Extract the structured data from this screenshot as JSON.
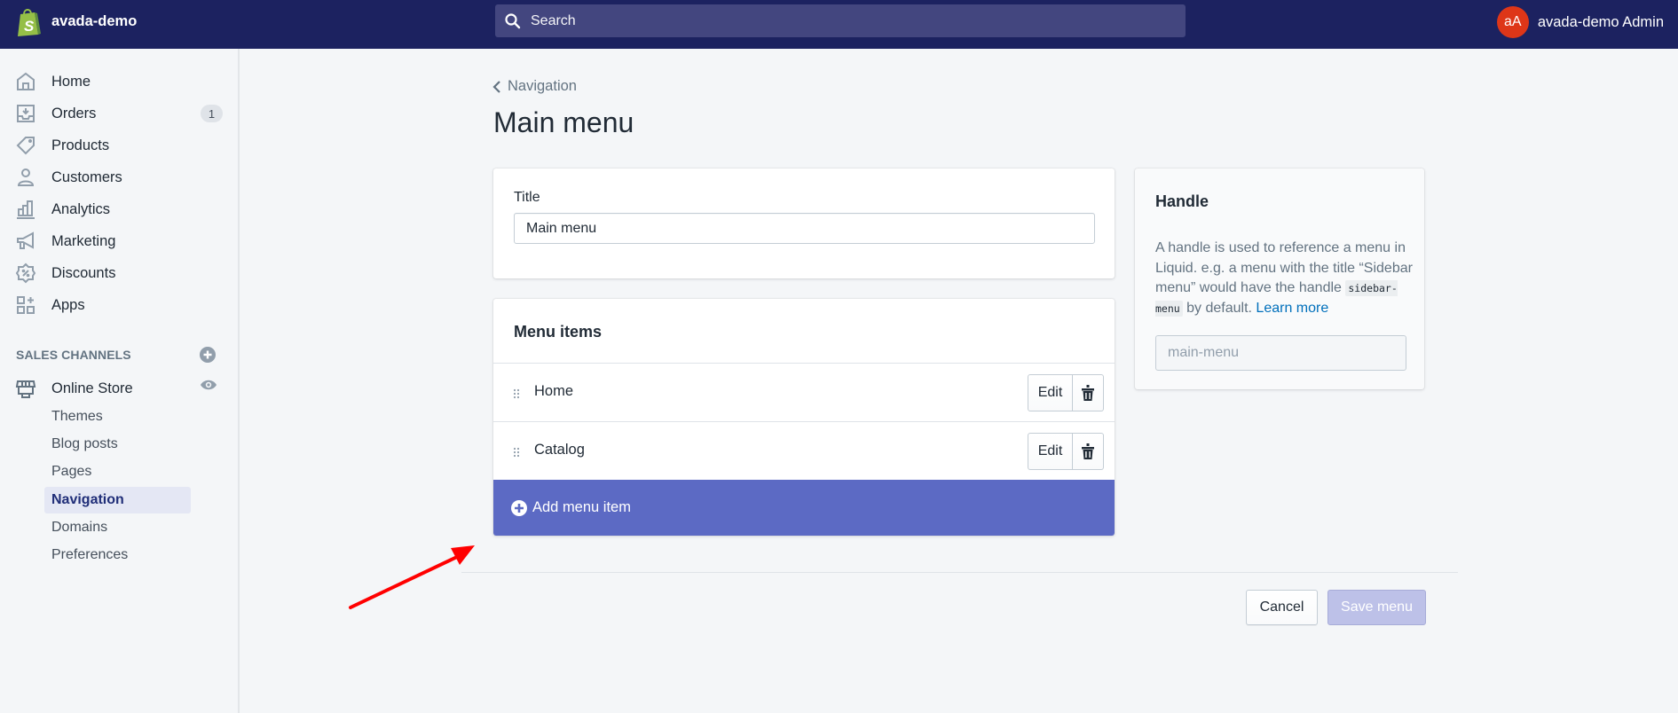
{
  "topbar": {
    "store_name": "avada-demo",
    "search_placeholder": "Search",
    "user_initials": "aA",
    "user_name": "avada-demo Admin",
    "colors": {
      "bar": "#1c2260",
      "search": "#43467f",
      "avatar": "#de3618"
    }
  },
  "sidebar": {
    "items": [
      {
        "label": "Home",
        "icon": "home-icon"
      },
      {
        "label": "Orders",
        "icon": "orders-icon",
        "badge": "1"
      },
      {
        "label": "Products",
        "icon": "tag-icon"
      },
      {
        "label": "Customers",
        "icon": "person-icon"
      },
      {
        "label": "Analytics",
        "icon": "bar-chart-icon"
      },
      {
        "label": "Marketing",
        "icon": "megaphone-icon"
      },
      {
        "label": "Discounts",
        "icon": "discount-icon"
      },
      {
        "label": "Apps",
        "icon": "apps-icon"
      }
    ],
    "sales_channels_heading": "SALES CHANNELS",
    "online_store": {
      "label": "Online Store",
      "icon": "store-icon"
    },
    "sub_items": [
      {
        "label": "Themes"
      },
      {
        "label": "Blog posts"
      },
      {
        "label": "Pages"
      },
      {
        "label": "Navigation",
        "active": true
      },
      {
        "label": "Domains"
      },
      {
        "label": "Preferences"
      }
    ]
  },
  "main": {
    "breadcrumb": "Navigation",
    "page_title": "Main menu",
    "title_card": {
      "label": "Title",
      "value": "Main menu"
    },
    "menu_card": {
      "heading": "Menu items",
      "items": [
        {
          "label": "Home",
          "edit_label": "Edit"
        },
        {
          "label": "Catalog",
          "edit_label": "Edit"
        }
      ],
      "add_label": "Add menu item",
      "add_color": "#5c6ac4"
    },
    "handle_card": {
      "heading": "Handle",
      "desc_part1": "A handle is used to reference a menu in Liquid. e.g. a menu with the title “Sidebar menu” would have the handle ",
      "code": "sidebar-menu",
      "desc_part2": " by default. ",
      "link": "Learn more",
      "input_value": "main-menu"
    },
    "footer": {
      "cancel_label": "Cancel",
      "save_label": "Save menu"
    }
  },
  "annotation": {
    "arrow_color": "#ff0000",
    "points_to": "add-menu-item-button"
  }
}
